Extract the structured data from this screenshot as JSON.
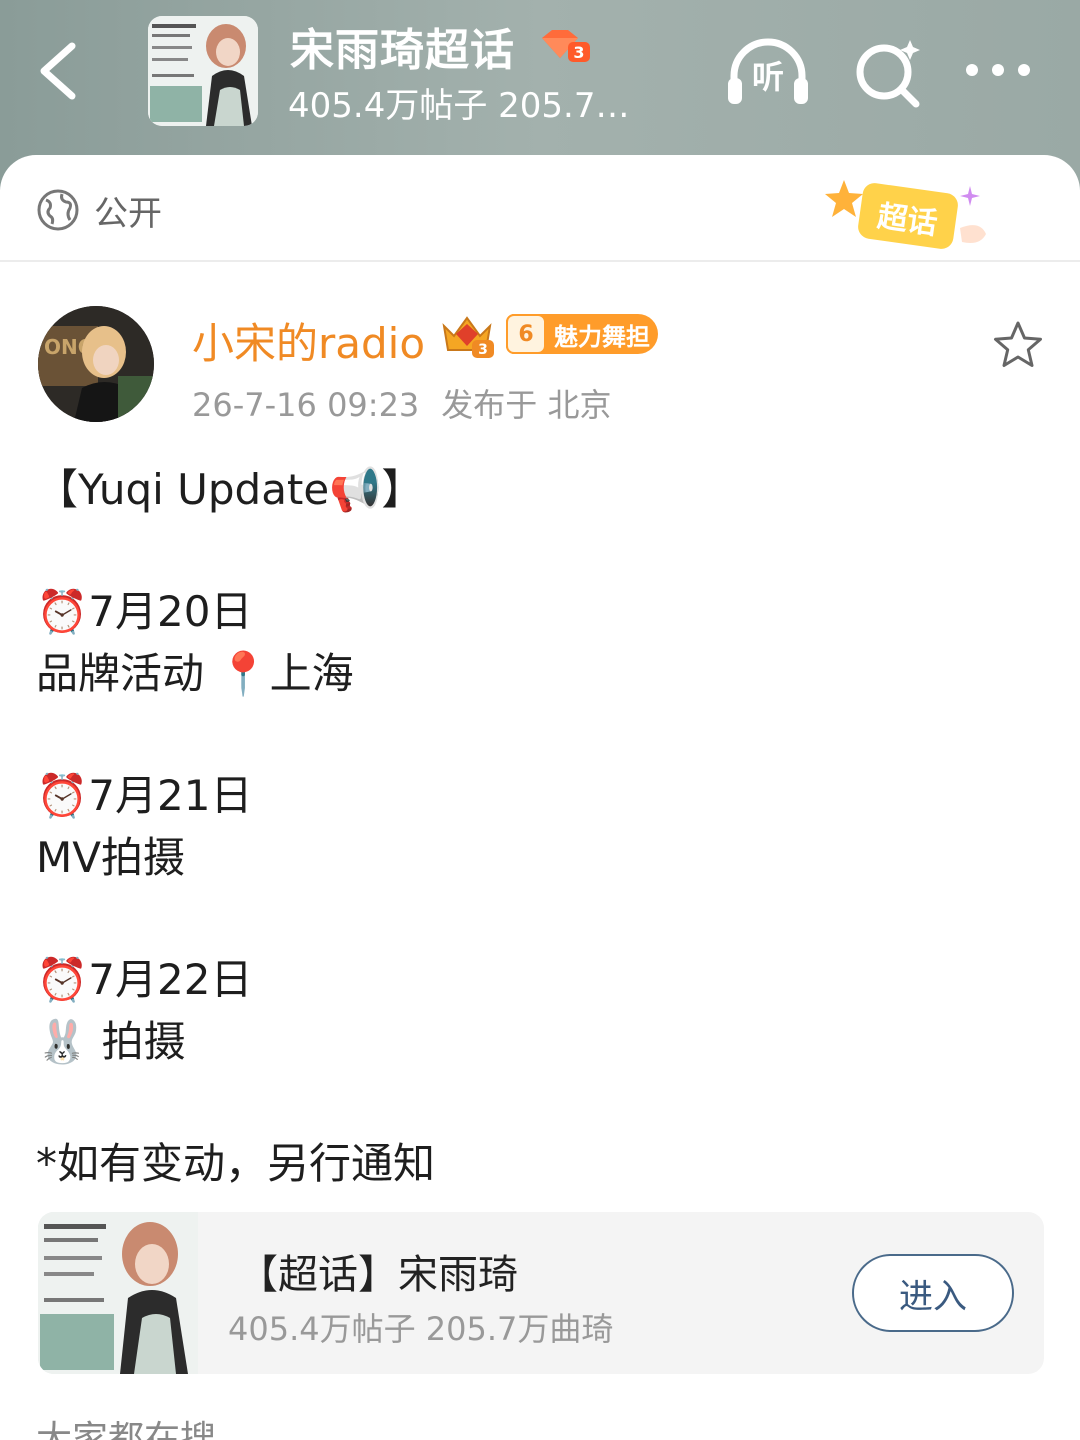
{
  "header": {
    "topic_title": "宋雨琦超话",
    "rank_level": "3",
    "topic_stats": "405.4万帖子 205.7万...",
    "listen_label": "听"
  },
  "visibility": {
    "label": "公开",
    "badge_text": "超话"
  },
  "post": {
    "author": "小宋的radio",
    "crown_level": "3",
    "fan_level": "6",
    "fan_title": "魅力舞担",
    "time": "26-7-16 09:23",
    "location": "发布于 北京",
    "lines": [
      "【Yuqi Update📢】",
      "⏰7月20日",
      "品牌活动 📍上海",
      "⏰7月21日",
      "MV拍摄",
      "⏰7月22日",
      "🐰 拍摄",
      "*如有变动，另行通知"
    ]
  },
  "topic_card": {
    "title": "【超话】宋雨琦",
    "stats": "405.4万帖子 205.7万曲琦",
    "enter_label": "进入"
  },
  "search_hint": "大家都在搜",
  "colors": {
    "header_bg": "#9aa9a5",
    "username": "#f08a24",
    "fan_badge": "#ff9c2a",
    "enter_border": "#4a6a8a"
  }
}
